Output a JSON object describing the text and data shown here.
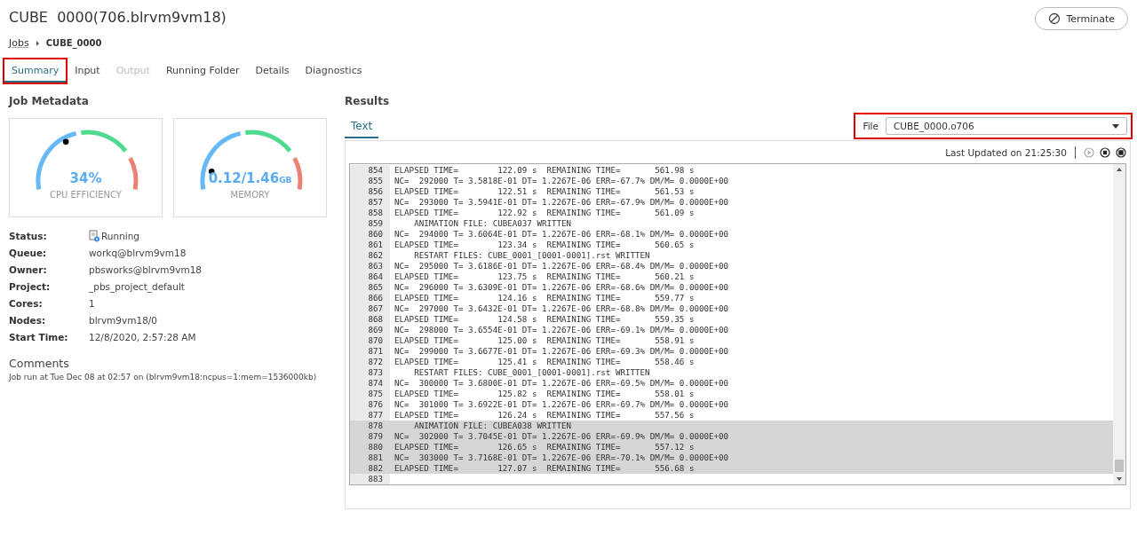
{
  "header": {
    "title": "CUBE  0000(706.blrvm9vm18)",
    "terminate_button": "Terminate"
  },
  "breadcrumb": [
    {
      "label": "Jobs",
      "kind": "link"
    },
    {
      "label": "CUBE_0000",
      "kind": "current"
    }
  ],
  "tabs": [
    {
      "label": "Summary",
      "selected": true,
      "disabled": false,
      "annotated": true
    },
    {
      "label": "Input",
      "selected": false,
      "disabled": false,
      "annotated": false
    },
    {
      "label": "Output",
      "selected": false,
      "disabled": true,
      "annotated": false
    },
    {
      "label": "Running Folder",
      "selected": false,
      "disabled": false,
      "annotated": false
    },
    {
      "label": "Details",
      "selected": false,
      "disabled": false,
      "annotated": false
    },
    {
      "label": "Diagnostics",
      "selected": false,
      "disabled": false,
      "annotated": false
    }
  ],
  "job_metadata": {
    "heading": "Job Metadata",
    "gauges": [
      {
        "value": "34%",
        "label": "CPU EFFICIENCY",
        "level": 0.34
      },
      {
        "value": "0.12/1.46",
        "unit": "GB",
        "label": "MEMORY",
        "level": 0.08
      }
    ],
    "fields": [
      {
        "label": "Status:",
        "value": "Running",
        "kind": "status"
      },
      {
        "label": "Queue:",
        "value": "workq@blrvm9vm18",
        "kind": "text"
      },
      {
        "label": "Owner:",
        "value": "pbsworks@blrvm9vm18",
        "kind": "text"
      },
      {
        "label": "Project:",
        "value": "_pbs_project_default",
        "kind": "text"
      },
      {
        "label": "Cores:",
        "value": "1",
        "kind": "text"
      },
      {
        "label": "Nodes:",
        "value": "blrvm9vm18/0",
        "kind": "text"
      },
      {
        "label": "Start Time:",
        "value": "12/8/2020, 2:57:28 AM",
        "kind": "text"
      }
    ],
    "comments_heading": "Comments",
    "comment": "Job run at Tue Dec 08 at 02:57 on (blrvm9vm18:ncpus=1:mem=1536000kb)"
  },
  "results": {
    "heading": "Results",
    "tabs": [
      {
        "label": "Text",
        "selected": true
      }
    ],
    "file_label": "File",
    "file_value": "CUBE_0000.o706",
    "file_annotated": true,
    "last_updated": "Last Updated on 21:25:30",
    "lines": [
      {
        "number": "854",
        "text": "ELAPSED TIME=        122.09 s  REMAINING TIME=       561.98 s",
        "selected": false
      },
      {
        "number": "855",
        "text": "NC=  292000 T= 3.5818E-01 DT= 1.2267E-06 ERR=-67.7% DM/M= 0.0000E+00",
        "selected": false
      },
      {
        "number": "856",
        "text": "ELAPSED TIME=        122.51 s  REMAINING TIME=       561.53 s",
        "selected": false
      },
      {
        "number": "857",
        "text": "NC=  293000 T= 3.5941E-01 DT= 1.2267E-06 ERR=-67.9% DM/M= 0.0000E+00",
        "selected": false
      },
      {
        "number": "858",
        "text": "ELAPSED TIME=        122.92 s  REMAINING TIME=       561.09 s",
        "selected": false
      },
      {
        "number": "859",
        "text": "    ANIMATION FILE: CUBEA037 WRITTEN",
        "selected": false
      },
      {
        "number": "860",
        "text": "NC=  294000 T= 3.6064E-01 DT= 1.2267E-06 ERR=-68.1% DM/M= 0.0000E+00",
        "selected": false
      },
      {
        "number": "861",
        "text": "ELAPSED TIME=        123.34 s  REMAINING TIME=       560.65 s",
        "selected": false
      },
      {
        "number": "862",
        "text": "    RESTART FILES: CUBE_0001_[0001-0001].rst WRITTEN",
        "selected": false
      },
      {
        "number": "863",
        "text": "NC=  295000 T= 3.6186E-01 DT= 1.2267E-06 ERR=-68.4% DM/M= 0.0000E+00",
        "selected": false
      },
      {
        "number": "864",
        "text": "ELAPSED TIME=        123.75 s  REMAINING TIME=       560.21 s",
        "selected": false
      },
      {
        "number": "865",
        "text": "NC=  296000 T= 3.6309E-01 DT= 1.2267E-06 ERR=-68.6% DM/M= 0.0000E+00",
        "selected": false
      },
      {
        "number": "866",
        "text": "ELAPSED TIME=        124.16 s  REMAINING TIME=       559.77 s",
        "selected": false
      },
      {
        "number": "867",
        "text": "NC=  297000 T= 3.6432E-01 DT= 1.2267E-06 ERR=-68.8% DM/M= 0.0000E+00",
        "selected": false
      },
      {
        "number": "868",
        "text": "ELAPSED TIME=        124.58 s  REMAINING TIME=       559.35 s",
        "selected": false
      },
      {
        "number": "869",
        "text": "NC=  298000 T= 3.6554E-01 DT= 1.2267E-06 ERR=-69.1% DM/M= 0.0000E+00",
        "selected": false
      },
      {
        "number": "870",
        "text": "ELAPSED TIME=        125.00 s  REMAINING TIME=       558.91 s",
        "selected": false
      },
      {
        "number": "871",
        "text": "NC=  299000 T= 3.6677E-01 DT= 1.2267E-06 ERR=-69.3% DM/M= 0.0000E+00",
        "selected": false
      },
      {
        "number": "872",
        "text": "ELAPSED TIME=        125.41 s  REMAINING TIME=       558.46 s",
        "selected": false
      },
      {
        "number": "873",
        "text": "    RESTART FILES: CUBE_0001_[0001-0001].rst WRITTEN",
        "selected": false
      },
      {
        "number": "874",
        "text": "NC=  300000 T= 3.6800E-01 DT= 1.2267E-06 ERR=-69.5% DM/M= 0.0000E+00",
        "selected": false
      },
      {
        "number": "875",
        "text": "ELAPSED TIME=        125.82 s  REMAINING TIME=       558.01 s",
        "selected": false
      },
      {
        "number": "876",
        "text": "NC=  301000 T= 3.6922E-01 DT= 1.2267E-06 ERR=-69.7% DM/M= 0.0000E+00",
        "selected": false
      },
      {
        "number": "877",
        "text": "ELAPSED TIME=        126.24 s  REMAINING TIME=       557.56 s",
        "selected": false
      },
      {
        "number": "878",
        "text": "    ANIMATION FILE: CUBEA038 WRITTEN",
        "selected": true
      },
      {
        "number": "879",
        "text": "NC=  302000 T= 3.7045E-01 DT= 1.2267E-06 ERR=-69.9% DM/M= 0.0000E+00",
        "selected": true
      },
      {
        "number": "880",
        "text": "ELAPSED TIME=        126.65 s  REMAINING TIME=       557.12 s",
        "selected": true
      },
      {
        "number": "881",
        "text": "NC=  303000 T= 3.7168E-01 DT= 1.2267E-06 ERR=-70.1% DM/M= 0.0000E+00",
        "selected": true
      },
      {
        "number": "882",
        "text": "ELAPSED TIME=        127.07 s  REMAINING TIME=       556.68 s",
        "selected": true
      },
      {
        "number": "883",
        "selected": false
      }
    ]
  }
}
